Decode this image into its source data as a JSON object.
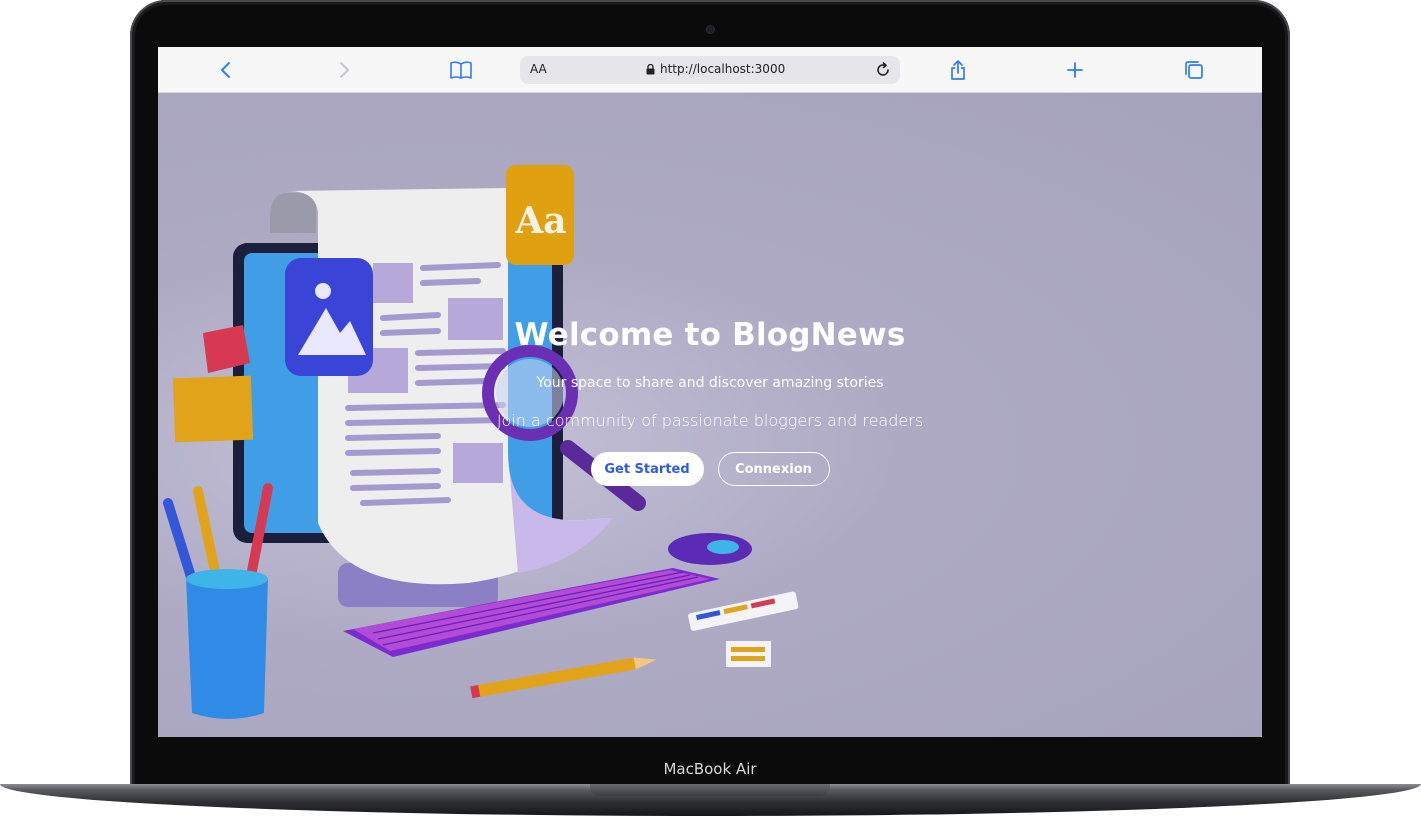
{
  "device": {
    "label": "MacBook Air"
  },
  "browser": {
    "text_size_label": "AA",
    "url": "http://localhost:3000",
    "icons": {
      "back": "chevron-left-icon",
      "forward": "chevron-right-icon",
      "bookmarks": "book-icon",
      "lock": "lock-icon",
      "reload": "reload-icon",
      "share": "share-icon",
      "new_tab": "plus-icon",
      "tabs": "tabs-icon"
    },
    "accent": "#2f7df6"
  },
  "hero": {
    "title": "Welcome to BlogNews",
    "subtitle": "Your space to share and discover amazing stories",
    "tagline": "Join a community of passionate bloggers and readers",
    "primary_button": "Get Started",
    "secondary_button": "Connexion",
    "primary_button_color": "#2f5be3"
  }
}
